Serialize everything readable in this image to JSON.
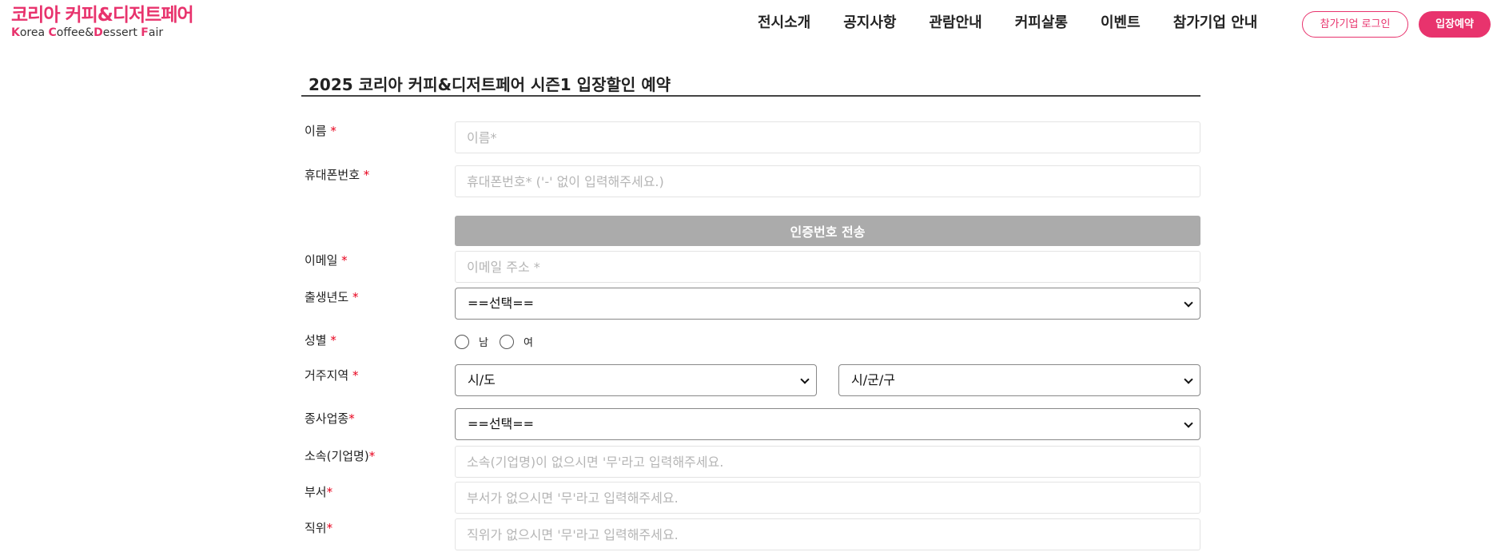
{
  "logo": {
    "korean": "코리아 커피&디저트페어",
    "english_parts": [
      {
        "text": "K",
        "hl": true
      },
      {
        "text": "orea ",
        "hl": false
      },
      {
        "text": "C",
        "hl": true
      },
      {
        "text": "offee&",
        "hl": false
      },
      {
        "text": "D",
        "hl": true
      },
      {
        "text": "essert ",
        "hl": false
      },
      {
        "text": "F",
        "hl": true
      },
      {
        "text": "air",
        "hl": false
      }
    ]
  },
  "nav": {
    "items": [
      "전시소개",
      "공지사항",
      "관람안내",
      "커피살롱",
      "이벤트",
      "참가기업 안내"
    ],
    "login_label": "참가기업 로그인",
    "reserve_label": "입장예약"
  },
  "page": {
    "title": "2025 코리아 커피&디저트페어 시즌1 입장할인 예약"
  },
  "form": {
    "required_mark": "*",
    "name": {
      "label": "이름 ",
      "placeholder": "이름*"
    },
    "phone": {
      "label": "휴대폰번호 ",
      "placeholder": "휴대폰번호* ('-' 없이 입력해주세요.)"
    },
    "verify_button": "인증번호 전송",
    "email": {
      "label": "이메일 ",
      "placeholder": "이메일 주소 *"
    },
    "birth_year": {
      "label": "출생년도 ",
      "selected": "==선택=="
    },
    "gender": {
      "label": "성별 ",
      "options": [
        "남",
        "여"
      ]
    },
    "region": {
      "label": "거주지역 ",
      "province_selected": "시/도",
      "city_selected": "시/군/구"
    },
    "industry": {
      "label": "종사업종",
      "selected": "==선택=="
    },
    "company": {
      "label": "소속(기업명)",
      "placeholder": "소속(기업명)이 없으시면 '무'라고 입력해주세요."
    },
    "department": {
      "label": "부서",
      "placeholder": "부서가 없으시면 '무'라고 입력해주세요."
    },
    "position": {
      "label": "직위",
      "placeholder": "직위가 없으시면 '무'라고 입력해주세요."
    }
  },
  "colors": {
    "brand": "#e8336d",
    "required": "#e8001c",
    "verify_button_bg": "#ababab"
  }
}
